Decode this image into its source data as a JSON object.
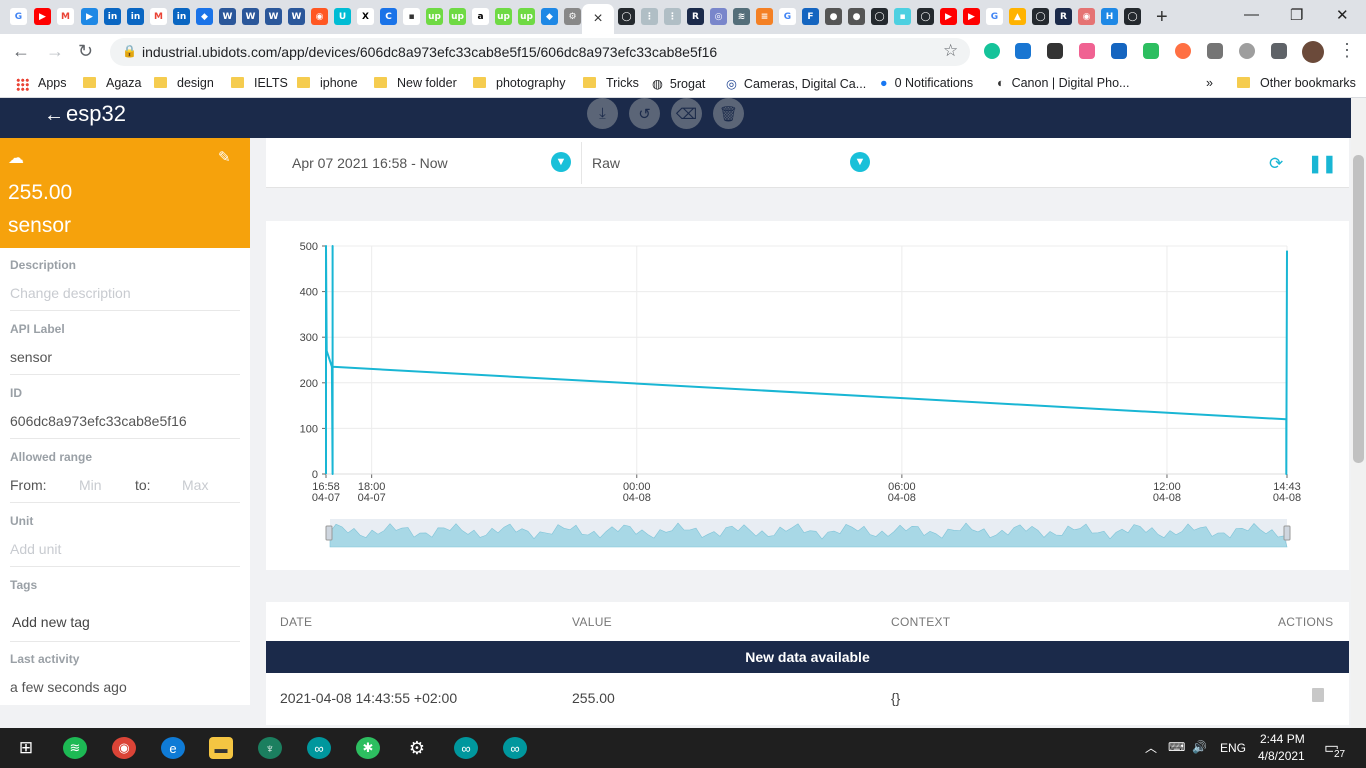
{
  "browser": {
    "tab_close": "×",
    "new_tab": "+",
    "window": {
      "minimize": "—",
      "maximize": "❐",
      "close": "✕"
    },
    "url": "industrial.ubidots.com/app/devices/606dc8a973efc33cab8e5f15/606dc8a973efc33cab8e5f16",
    "bookmarks": [
      "Apps",
      "Agaza",
      "design",
      "IELTS",
      "iphone",
      "New folder",
      "photography",
      "Tricks",
      "5rogat",
      "Cameras, Digital Ca...",
      "0 Notifications",
      "Canon | Digital Pho..."
    ],
    "bookmarks_more": "»",
    "other_bookmarks": "Other bookmarks"
  },
  "header": {
    "back_glyph": "←",
    "device_name": "esp32"
  },
  "variable": {
    "value": "255.00",
    "name": "sensor",
    "description_label": "Description",
    "description_placeholder": "Change description",
    "api_label_label": "API Label",
    "api_label": "sensor",
    "id_label": "ID",
    "id": "606dc8a973efc33cab8e5f16",
    "range_label": "Allowed range",
    "range_from": "From:",
    "range_min": "Min",
    "range_to": "to:",
    "range_max": "Max",
    "unit_label": "Unit",
    "unit_placeholder": "Add unit",
    "tags_label": "Tags",
    "tags_placeholder": "Add new tag",
    "activity_label": "Last activity",
    "activity": "a few seconds ago"
  },
  "filters": {
    "date_range": "Apr 07 2021 16:58 - Now",
    "aggregation": "Raw"
  },
  "chart_data": {
    "type": "line",
    "series": [
      {
        "x": [
          "2021-04-07 16:58",
          "2021-04-07 16:58",
          "2021-04-07 16:59",
          "2021-04-07 17:06",
          "2021-04-07 17:07",
          "2021-04-07 17:07",
          "2021-04-07 17:07",
          "2021-04-08 14:42",
          "2021-04-08 14:42",
          "2021-04-08 14:43"
        ],
        "values": [
          0,
          500,
          270,
          235,
          0,
          500,
          235,
          120,
          0,
          490
        ]
      }
    ],
    "x_ticks": [
      {
        "time": "16:58",
        "date": "04-07"
      },
      {
        "time": "18:00",
        "date": "04-07"
      },
      {
        "time": "00:00",
        "date": "04-08"
      },
      {
        "time": "06:00",
        "date": "04-08"
      },
      {
        "time": "12:00",
        "date": "04-08"
      },
      {
        "time": "14:43",
        "date": "04-08"
      }
    ],
    "y_ticks": [
      0,
      100,
      200,
      300,
      400,
      500
    ],
    "ylim": [
      0,
      500
    ],
    "grid": true,
    "color": "#19b6d4"
  },
  "table": {
    "headers": [
      "DATE",
      "VALUE",
      "CONTEXT",
      "ACTIONS"
    ],
    "banner": "New data available",
    "rows": [
      {
        "date": "2021-04-08 14:43:55 +02:00",
        "value": "255.00",
        "context": "{}"
      }
    ]
  },
  "taskbar": {
    "time": "2:44 PM",
    "date": "4/8/2021",
    "lang": "ENG",
    "notifications": "27"
  }
}
